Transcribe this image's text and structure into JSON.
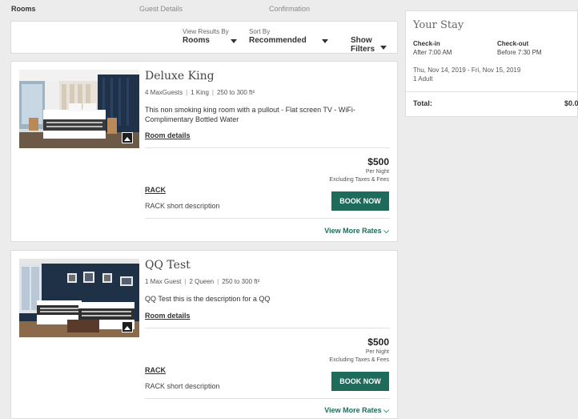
{
  "steps": {
    "rooms": "Rooms",
    "guest_details": "Guest Details",
    "confirmation": "Confirmation"
  },
  "filters": {
    "view_results_label": "View Results By",
    "view_results_value": "Rooms",
    "sort_label": "Sort By",
    "sort_value": "Recommended",
    "show_filters": "Show Filters"
  },
  "rooms": [
    {
      "name": "Deluxe King",
      "guests": "4 MaxGuests",
      "beds": "1 King",
      "size": "250 to 300 ft²",
      "description": "This non smoking king room with a pullout - Flat screen TV - WiFi- Complimentary Bottled Water",
      "details_link": "Room details",
      "price": "$500",
      "per_night": "Per Night",
      "taxes": "Excluding Taxes & Fees",
      "rate_name": "RACK",
      "rate_description": "RACK short description",
      "book_label": "BOOK NOW",
      "more_rates": "View More Rates"
    },
    {
      "name": "QQ Test",
      "guests": "1 Max Guest",
      "beds": "2 Queen",
      "size": "250 to 300 ft²",
      "description": "QQ Test this is the description for a QQ",
      "details_link": "Room details",
      "price": "$500",
      "per_night": "Per Night",
      "taxes": "Excluding Taxes & Fees",
      "rate_name": "RACK",
      "rate_description": "RACK short description",
      "book_label": "BOOK NOW",
      "more_rates": "View More Rates"
    }
  ],
  "stay": {
    "title": "Your Stay",
    "checkin_label": "Check-in",
    "checkin_value": "After 7:00 AM",
    "checkout_label": "Check-out",
    "checkout_value": "Before 7:30 PM",
    "dates": "Thu, Nov 14, 2019 - Fri, Nov 15, 2019",
    "guests": "1 Adult",
    "total_label": "Total:",
    "total_value": "$0.0"
  },
  "colors": {
    "accent": "#1f6b5b",
    "background": "#ececec"
  }
}
